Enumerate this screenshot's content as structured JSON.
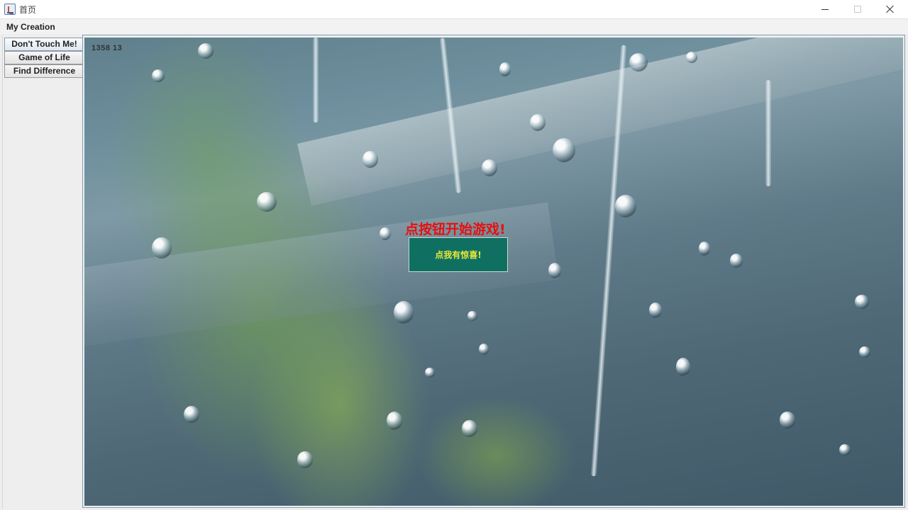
{
  "window": {
    "title": "首页"
  },
  "menubar": {
    "items": [
      {
        "label": "My Creation"
      }
    ]
  },
  "tabs": [
    {
      "label": "Don't Touch Me!",
      "selected": true
    },
    {
      "label": "Game of Life",
      "selected": false
    },
    {
      "label": "Find Difference",
      "selected": false
    }
  ],
  "game": {
    "coordinates": "1358  13",
    "prompt": "点按钮开始游戏!",
    "button_label": "点我有惊喜!",
    "background_image": "rainy-window-with-plants",
    "colors": {
      "prompt": "#e61010",
      "button_bg": "#0f7062",
      "button_text": "#e8e83a"
    }
  },
  "icons": {
    "app": "java-cup-icon",
    "minimize": "minimize-icon",
    "maximize": "maximize-icon",
    "close": "close-icon"
  }
}
